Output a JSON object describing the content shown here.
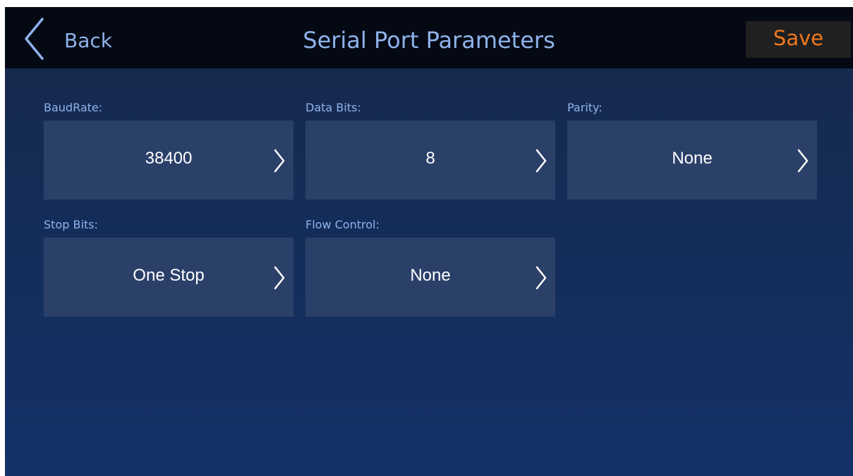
{
  "header": {
    "back_label": "Back",
    "title": "Serial Port Parameters",
    "save_label": "Save"
  },
  "fields": [
    {
      "label": "BaudRate:",
      "value": "38400"
    },
    {
      "label": "Data Bits:",
      "value": "8"
    },
    {
      "label": "Parity:",
      "value": "None"
    },
    {
      "label": "Stop Bits:",
      "value": "One Stop"
    },
    {
      "label": "Flow Control:",
      "value": "None"
    }
  ],
  "icons": {
    "back": "chevron-left-icon",
    "field_arrow": "chevron-right-icon"
  },
  "colors": {
    "header_bg": "#040914",
    "accent_text": "#8fb2ea",
    "save_text": "#f0781e",
    "field_bg": "#2b4069",
    "value_text": "#ffffff"
  }
}
